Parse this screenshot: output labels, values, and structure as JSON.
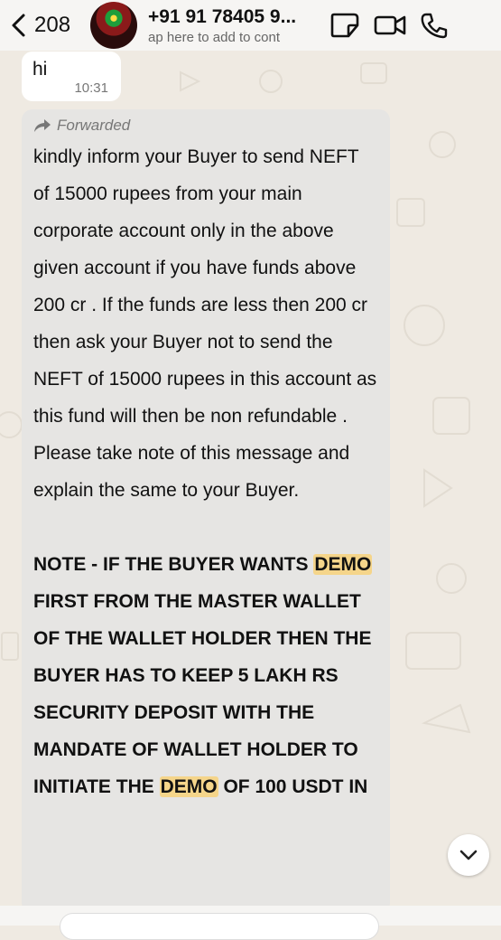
{
  "header": {
    "back_count": "208",
    "contact_name": "+91 91 78405 9...",
    "contact_sub": "ap here to add to cont",
    "icons": [
      "chevron-left-icon",
      "sticker-icon",
      "video-icon",
      "phone-icon"
    ]
  },
  "messages": {
    "hi": {
      "text": "hi",
      "time": "10:31"
    },
    "forwarded": {
      "label": "Forwarded",
      "para1": "kindly inform your Buyer to send NEFT of 15000 rupees from your main corporate account only in the above given account if you have funds above 200 cr . If the funds are less then 200 cr then ask your Buyer not to send the NEFT of 15000 rupees in this account as this fund will then be non refundable . Please take note of this message and explain the same to your Buyer.",
      "note": {
        "seg1": "NOTE - IF THE BUYER WANTS ",
        "hl1": "DEMO",
        "seg2": " FIRST FROM THE MASTER WALLET OF THE WALLET HOLDER THEN THE BUYER HAS TO KEEP 5 LAKH RS SECURITY DEPOSIT WITH THE MANDATE OF WALLET HOLDER TO INITIATE THE ",
        "hl2": "DEMO",
        "seg3": " OF 100 USDT IN"
      }
    }
  },
  "colors": {
    "bubble_incoming": "#ffffff",
    "bubble_forwarded": "#e6e5e3",
    "highlight": "#f5d58a",
    "background": "#efeae2"
  }
}
